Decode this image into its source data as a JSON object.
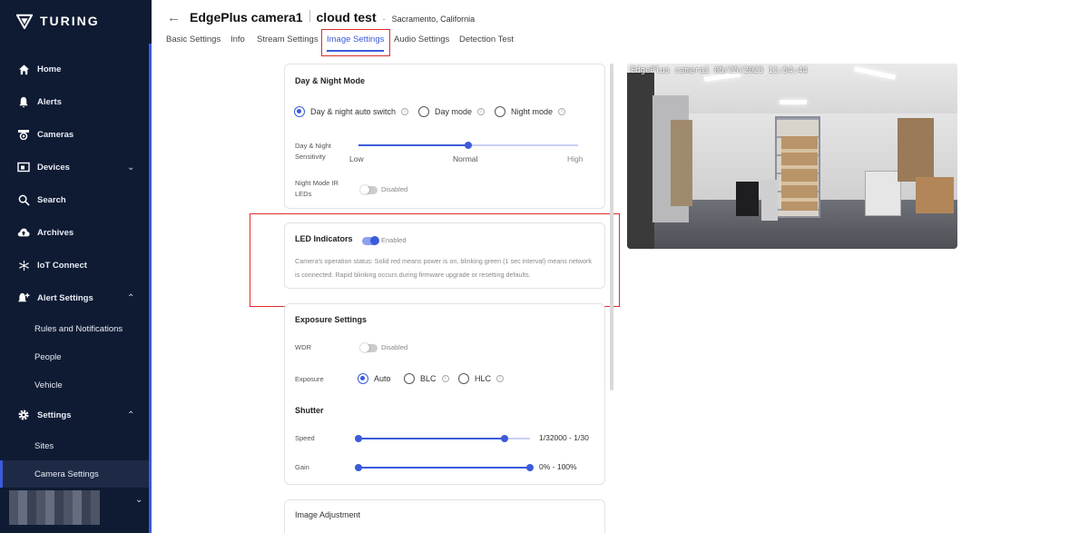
{
  "app": {
    "logo_text": "TURING"
  },
  "sidebar": {
    "items": [
      {
        "label": "Home",
        "icon": "home-icon"
      },
      {
        "label": "Alerts",
        "icon": "bell-icon"
      },
      {
        "label": "Cameras",
        "icon": "camera-icon"
      },
      {
        "label": "Devices",
        "icon": "devices-icon"
      },
      {
        "label": "Search",
        "icon": "search-icon"
      },
      {
        "label": "Archives",
        "icon": "cloud-upload-icon"
      },
      {
        "label": "IoT Connect",
        "icon": "iot-icon"
      },
      {
        "label": "Alert Settings",
        "icon": "alert-settings-icon"
      },
      {
        "label": "Rules and Notifications"
      },
      {
        "label": "People"
      },
      {
        "label": "Vehicle"
      },
      {
        "label": "Settings",
        "icon": "gear-icon"
      },
      {
        "label": "Sites"
      },
      {
        "label": "Camera Settings"
      }
    ]
  },
  "header": {
    "camera_name": "EdgePlus camera1",
    "site_name": "cloud test",
    "location_separator": "-",
    "location": "Sacramento, California"
  },
  "tabs": [
    {
      "label": "Basic Settings"
    },
    {
      "label": "Info"
    },
    {
      "label": "Stream Settings"
    },
    {
      "label": "Image Settings"
    },
    {
      "label": "Audio Settings"
    },
    {
      "label": "Detection Test"
    }
  ],
  "day_night": {
    "title": "Day & Night Mode",
    "options": [
      {
        "label": "Day & night auto switch",
        "selected": true
      },
      {
        "label": "Day mode",
        "selected": false
      },
      {
        "label": "Night mode",
        "selected": false
      }
    ],
    "sensitivity_label_1": "Day & Night",
    "sensitivity_label_2": "Sensitivity",
    "sensitivity_value": 0.5,
    "sensitivity_low": "Low",
    "sensitivity_normal": "Normal",
    "sensitivity_high": "High",
    "ir_label_1": "Night Mode IR",
    "ir_label_2": "LEDs",
    "ir_status": "Disabled",
    "ir_enabled": false
  },
  "led": {
    "title": "LED Indicators",
    "status": "Enabled",
    "enabled": true,
    "description": "Camera's operation status: Solid red means power is on, blinking green (1 sec interval) means network is connected. Rapid blinking occurs during firmware upgrade or resetting defaults."
  },
  "exposure": {
    "title": "Exposure Settings",
    "wdr_label": "WDR",
    "wdr_status": "Disabled",
    "wdr_enabled": false,
    "exposure_label": "Exposure",
    "options": [
      {
        "label": "Auto",
        "selected": true
      },
      {
        "label": "BLC",
        "selected": false
      },
      {
        "label": "HLC",
        "selected": false
      }
    ],
    "shutter_title": "Shutter",
    "speed_label": "Speed",
    "speed_range": "1/32000 - 1/30",
    "speed_fraction": 0.85,
    "gain_label": "Gain",
    "gain_range": "0% - 100%",
    "gain_fraction": 1.0
  },
  "image_adjustment": {
    "title": "Image Adjustment"
  },
  "preview": {
    "timestamp": "EdgePlus camera1 05/25/2023 11:54:44"
  },
  "colors": {
    "sidebar_bg": "#0f1b33",
    "accent": "#3b5bdb",
    "highlight": "#e02b2b"
  }
}
